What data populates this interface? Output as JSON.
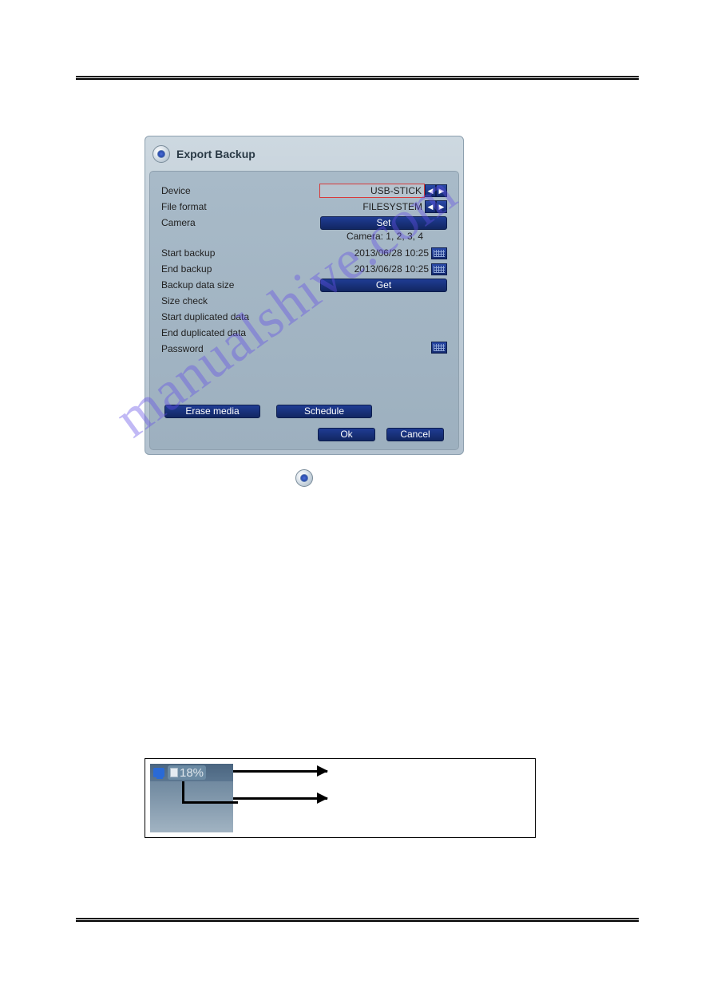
{
  "dialog": {
    "title": "Export Backup",
    "rows": {
      "device": {
        "label": "Device",
        "value": "USB-STICK"
      },
      "file_format": {
        "label": "File format",
        "value": "FILESYSTEM"
      },
      "camera": {
        "label": "Camera",
        "set_btn": "Set",
        "selected": "Camera: 1, 2, 3, 4"
      },
      "start_backup": {
        "label": "Start backup",
        "value": "2013/06/28 10:25"
      },
      "end_backup": {
        "label": "End backup",
        "value": "2013/06/28 10:25"
      },
      "backup_size": {
        "label": "Backup data size",
        "get_btn": "Get"
      },
      "size_check": {
        "label": "Size check"
      },
      "start_dup": {
        "label": "Start duplicated data"
      },
      "end_dup": {
        "label": "End duplicated data"
      },
      "password": {
        "label": "Password"
      }
    },
    "buttons": {
      "erase": "Erase media",
      "schedule": "Schedule",
      "ok": "Ok",
      "cancel": "Cancel"
    }
  },
  "callout": {
    "percent": "18%"
  },
  "watermark": "manualshive.com"
}
